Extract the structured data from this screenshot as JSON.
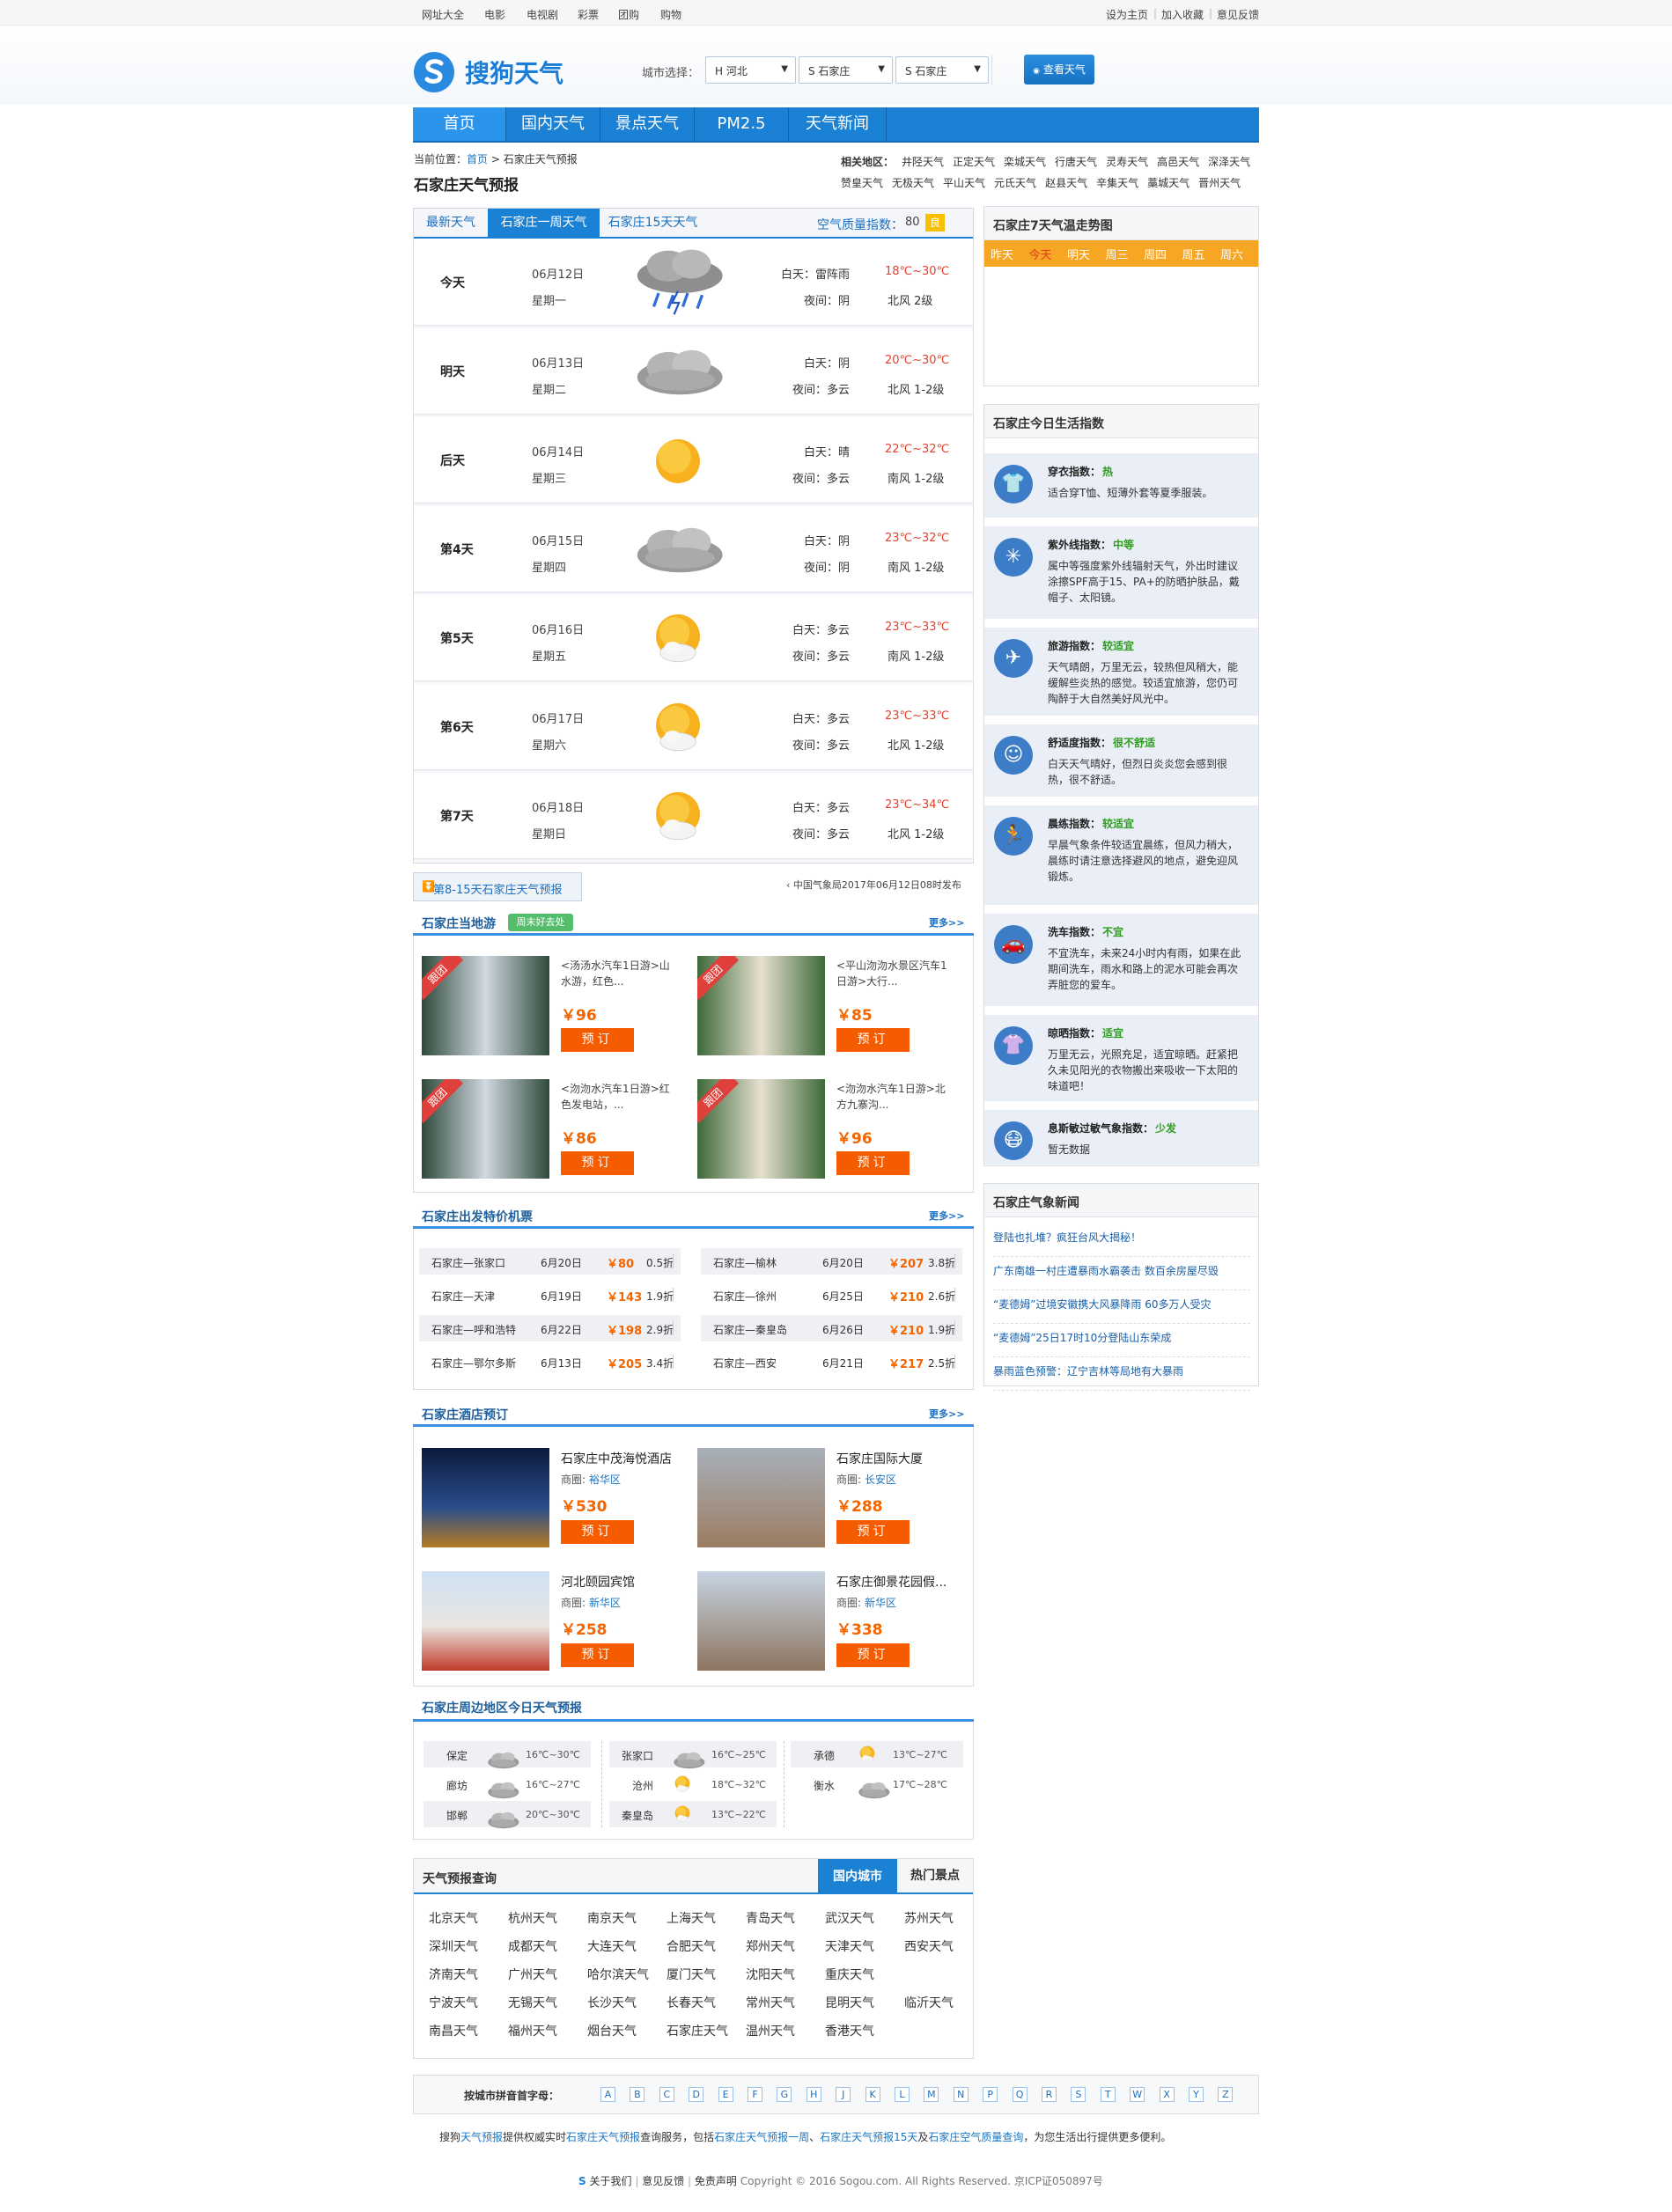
{
  "topbar": {
    "left": [
      "网址大全",
      "电影",
      "电视剧",
      "彩票",
      "团购",
      "购物"
    ],
    "right": [
      "设为主页",
      "加入收藏",
      "意见反馈"
    ]
  },
  "logo": {
    "text": "搜狗天气"
  },
  "city_select": {
    "label": "城市选择：",
    "province": "H 河北",
    "city": "S 石家庄",
    "district": "S 石家庄",
    "button": "查看天气"
  },
  "nav": [
    "首页",
    "国内天气",
    "景点天气",
    "PM2.5",
    "天气新闻"
  ],
  "breadcrumb": {
    "label": "当前位置：",
    "home": "首页",
    "sep": ">",
    "current": "石家庄天气预报"
  },
  "page_title": "石家庄天气预报",
  "related": {
    "label": "相关地区：",
    "row1": [
      "井陉天气",
      "正定天气",
      "栾城天气",
      "行唐天气",
      "灵寿天气",
      "高邑天气",
      "深泽天气"
    ],
    "row2": [
      "赞皇天气",
      "无极天气",
      "平山天气",
      "元氏天气",
      "赵县天气",
      "辛集天气",
      "藁城天气",
      "晋州天气"
    ]
  },
  "tabs": [
    "最新天气",
    "石家庄一周天气",
    "石家庄15天天气"
  ],
  "aqi": {
    "label": "空气质量指数：",
    "value": "80",
    "level": "良"
  },
  "forecast": [
    {
      "day": "今天",
      "date": "06月12日",
      "week": "星期一",
      "icon": "thunder-rain",
      "day_w": "白天：雷阵雨",
      "night_w": "夜间：阴",
      "temp": "18℃~30℃",
      "wind": "北风 2级"
    },
    {
      "day": "明天",
      "date": "06月13日",
      "week": "星期二",
      "icon": "cloudy",
      "day_w": "白天：阴",
      "night_w": "夜间：多云",
      "temp": "20℃~30℃",
      "wind": "北风 1-2级"
    },
    {
      "day": "后天",
      "date": "06月14日",
      "week": "星期三",
      "icon": "sunny",
      "day_w": "白天：晴",
      "night_w": "夜间：多云",
      "temp": "22℃~32℃",
      "wind": "南风 1-2级"
    },
    {
      "day": "第4天",
      "date": "06月15日",
      "week": "星期四",
      "icon": "cloudy",
      "day_w": "白天：阴",
      "night_w": "夜间：阴",
      "temp": "23℃~32℃",
      "wind": "南风 1-2级"
    },
    {
      "day": "第5天",
      "date": "06月16日",
      "week": "星期五",
      "icon": "partly-cloudy",
      "day_w": "白天：多云",
      "night_w": "夜间：多云",
      "temp": "23℃~33℃",
      "wind": "南风 1-2级"
    },
    {
      "day": "第6天",
      "date": "06月17日",
      "week": "星期六",
      "icon": "partly-cloudy",
      "day_w": "白天：多云",
      "night_w": "夜间：多云",
      "temp": "23℃~33℃",
      "wind": "北风 1-2级"
    },
    {
      "day": "第7天",
      "date": "06月18日",
      "week": "星期日",
      "icon": "partly-cloudy",
      "day_w": "白天：多云",
      "night_w": "夜间：多云",
      "temp": "23℃~34℃",
      "wind": "北风 1-2级"
    }
  ],
  "more15": "第8-15天石家庄天气预报",
  "publish": "中国气象局2017年06月12日08时发布",
  "travel": {
    "title": "石家庄当地游",
    "tag": "周末好去处",
    "more": "更多>>",
    "ribbon": "跟团",
    "book": "预订",
    "items": [
      {
        "text": "<汤汤水汽车1日游>山水游，红色...",
        "price": "￥96"
      },
      {
        "text": "<平山沕沕水景区汽车1日游>大行...",
        "price": "￥85"
      },
      {
        "text": "<沕沕水汽车1日游>红色发电站，...",
        "price": "￥86"
      },
      {
        "text": "<沕沕水汽车1日游>北方九寨沟...",
        "price": "￥96"
      }
    ]
  },
  "flights": {
    "title": "石家庄出发特价机票",
    "more": "更多>>",
    "left": [
      {
        "route": "石家庄—张家口",
        "date": "6月20日",
        "price": "￥80",
        "disc": "0.5折"
      },
      {
        "route": "石家庄—天津",
        "date": "6月19日",
        "price": "￥143",
        "disc": "1.9折"
      },
      {
        "route": "石家庄—呼和浩特",
        "date": "6月22日",
        "price": "￥198",
        "disc": "2.9折"
      },
      {
        "route": "石家庄—鄂尔多斯",
        "date": "6月13日",
        "price": "￥205",
        "disc": "3.4折"
      }
    ],
    "right": [
      {
        "route": "石家庄—榆林",
        "date": "6月20日",
        "price": "￥207",
        "disc": "3.8折"
      },
      {
        "route": "石家庄—徐州",
        "date": "6月25日",
        "price": "￥210",
        "disc": "2.6折"
      },
      {
        "route": "石家庄—秦皇岛",
        "date": "6月26日",
        "price": "￥210",
        "disc": "1.9折"
      },
      {
        "route": "石家庄—西安",
        "date": "6月21日",
        "price": "￥217",
        "disc": "2.5折"
      }
    ]
  },
  "hotels": {
    "title": "石家庄酒店预订",
    "more": "更多>>",
    "area_label": "商圈:",
    "book": "预订",
    "items": [
      {
        "name": "石家庄中茂海悦酒店",
        "area": "裕华区",
        "price": "￥530"
      },
      {
        "name": "石家庄国际大厦",
        "area": "长安区",
        "price": "￥288"
      },
      {
        "name": "河北颐园宾馆",
        "area": "新华区",
        "price": "￥258"
      },
      {
        "name": "石家庄御景花园假...",
        "area": "新华区",
        "price": "￥338"
      }
    ]
  },
  "nearby": {
    "title": "石家庄周边地区今日天气预报",
    "cols": [
      [
        {
          "city": "保定",
          "icon": "cloudy",
          "temp": "16℃~30℃"
        },
        {
          "city": "廊坊",
          "icon": "cloudy",
          "temp": "16℃~27℃"
        },
        {
          "city": "邯郸",
          "icon": "cloudy",
          "temp": "20℃~30℃"
        }
      ],
      [
        {
          "city": "张家口",
          "icon": "cloudy",
          "temp": "16℃~25℃"
        },
        {
          "city": "沧州",
          "icon": "partly-cloudy",
          "temp": "18℃~32℃"
        },
        {
          "city": "秦皇岛",
          "icon": "partly-cloudy",
          "temp": "13℃~22℃"
        }
      ],
      [
        {
          "city": "承德",
          "icon": "partly-cloudy",
          "temp": "13℃~27℃"
        },
        {
          "city": "衡水",
          "icon": "cloudy",
          "temp": "17℃~28℃"
        }
      ]
    ]
  },
  "query": {
    "title": "天气预报查询",
    "tab1": "国内城市",
    "tab2": "热门景点",
    "cities": [
      [
        "北京天气",
        "杭州天气",
        "南京天气",
        "上海天气",
        "青岛天气",
        "武汉天气",
        "苏州天气"
      ],
      [
        "深圳天气",
        "成都天气",
        "大连天气",
        "合肥天气",
        "郑州天气",
        "天津天气",
        "西安天气"
      ],
      [
        "济南天气",
        "广州天气",
        "哈尔滨天气",
        "厦门天气",
        "沈阳天气",
        "重庆天气"
      ],
      [
        "宁波天气",
        "无锡天气",
        "长沙天气",
        "长春天气",
        "常州天气",
        "昆明天气",
        "临沂天气"
      ],
      [
        "南昌天气",
        "福州天气",
        "烟台天气",
        "石家庄天气",
        "温州天气",
        "香港天气"
      ]
    ]
  },
  "trend": {
    "title": "石家庄7天气温走势图",
    "days": [
      "昨天",
      "今天",
      "明天",
      "周三",
      "周四",
      "周五",
      "周六"
    ]
  },
  "life": {
    "title": "石家庄今日生活指数",
    "items": [
      {
        "icon": "shirt",
        "name": "穿衣指数：",
        "level": "热",
        "desc": "适合穿T恤、短薄外套等夏季服装。"
      },
      {
        "icon": "sun",
        "name": "紫外线指数：",
        "level": "中等",
        "desc": "属中等强度紫外线辐射天气，外出时建议涂擦SPF高于15、PA+的防晒护肤品，戴帽子、太阳镜。"
      },
      {
        "icon": "plane",
        "name": "旅游指数：",
        "level": "较适宜",
        "desc": "天气晴朗，万里无云，较热但风稍大，能缓解些炎热的感觉。较适宜旅游，您仍可陶醉于大自然美好风光中。"
      },
      {
        "icon": "smile",
        "name": "舒适度指数：",
        "level": "很不舒适",
        "desc": "白天天气晴好，但烈日炎炎您会感到很热，很不舒适。"
      },
      {
        "icon": "run",
        "name": "晨练指数：",
        "level": "较适宜",
        "desc": "早晨气象条件较适宜晨练，但风力稍大，晨练时请注意选择避风的地点，避免迎风锻炼。"
      },
      {
        "icon": "car",
        "name": "洗车指数：",
        "level": "不宜",
        "desc": "不宜洗车，未来24小时内有雨，如果在此期间洗车，雨水和路上的泥水可能会再次弄脏您的爱车。"
      },
      {
        "icon": "tshirt",
        "name": "晾晒指数：",
        "level": "适宜",
        "desc": "万里无云，光照充足，适宜晾晒。赶紧把久未见阳光的衣物搬出来吸收一下太阳的味道吧！"
      },
      {
        "icon": "mask",
        "name": "息斯敏过敏气象指数：",
        "level": "少发",
        "desc": "暂无数据"
      }
    ]
  },
  "news": {
    "title": "石家庄气象新闻",
    "items": [
      "登陆也扎堆？疯狂台风大揭秘！",
      "广东南雄一村庄遭暴雨水霸袭击 数百余房屋尽毁",
      "“麦德姆”过境安徽携大风暴降雨 60多万人受灾",
      "“麦德姆”25日17时10分登陆山东荣成",
      "暴雨蓝色预警：辽宁吉林等局地有大暴雨"
    ]
  },
  "alpha": {
    "label": "按城市拼音首字母：",
    "letters": [
      "A",
      "B",
      "C",
      "D",
      "E",
      "F",
      "G",
      "H",
      "J",
      "K",
      "L",
      "M",
      "N",
      "P",
      "Q",
      "R",
      "S",
      "T",
      "W",
      "X",
      "Y",
      "Z"
    ]
  },
  "footer": {
    "line1_a": "搜狗",
    "line1_link1": "天气预报",
    "line1_b": "提供权威实时",
    "line1_link2": "石家庄天气预报",
    "line1_c": "查询服务，包括",
    "line1_link3": "石家庄天气预报一周",
    "line1_d": "、",
    "line1_link4": "石家庄天气预报15天",
    "line1_e": "及",
    "line1_link5": "石家庄空气质量查询",
    "line1_f": "，为您生活出行提供更多便利。",
    "about": "关于我们",
    "feedback": "意见反馈",
    "disclaimer": "免责声明",
    "copyright": "Copyright © 2016 Sogou.com. All Rights Reserved. 京ICP证050897号"
  },
  "colors": {
    "nav": "#1a81d4",
    "orange_btn": "#f55c00",
    "trend_bar": "#f7a624",
    "temp_red": "#e2412d"
  }
}
